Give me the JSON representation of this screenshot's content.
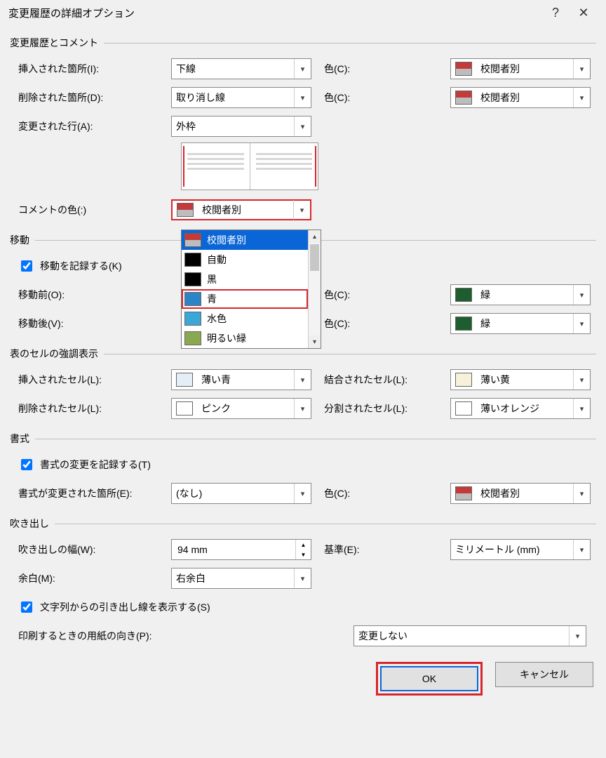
{
  "dialog": {
    "title": "変更履歴の詳細オプション"
  },
  "sections": {
    "tracking": "変更履歴とコメント",
    "move": "移動",
    "tableHighlight": "表のセルの強調表示",
    "format": "書式",
    "balloon": "吹き出し"
  },
  "labels": {
    "insert": "挿入された箇所(I):",
    "delete": "削除された箇所(D):",
    "changedLine": "変更された行(A):",
    "commentColor": "コメントの色(:)",
    "trackMove": "移動を記録する(K)",
    "moveBefore": "移動前(O):",
    "moveAfter": "移動後(V):",
    "cellInsert": "挿入されたセル(L):",
    "cellDelete": "削除されたセル(L):",
    "cellMerge": "結合されたセル(L):",
    "cellSplit": "分割されたセル(L):",
    "trackFormat": "書式の変更を記録する(T)",
    "formatChanged": "書式が変更された箇所(E):",
    "balloonWidth": "吹き出しの幅(W):",
    "reference": "基準(E):",
    "margin": "余白(M):",
    "showLeader": "文字列からの引き出し線を表示する(S)",
    "paperOrient": "印刷するときの用紙の向き(P):",
    "color": "色(C):"
  },
  "values": {
    "insert": "下線",
    "delete": "取り消し線",
    "changedLine": "外枠",
    "insertColor": "校閲者別",
    "deleteColor": "校閲者別",
    "commentColor": "校閲者別",
    "moveBeforeColor": "緑",
    "moveAfterColor": "緑",
    "cellInsert": "薄い青",
    "cellDelete": "ピンク",
    "cellMerge": "薄い黄",
    "cellSplit": "薄いオレンジ",
    "formatChanged": "(なし)",
    "formatColor": "校閲者別",
    "balloonWidth": "94 mm",
    "reference": "ミリメートル (mm)",
    "margin": "右余白",
    "paperOrient": "変更しない"
  },
  "dropdown": {
    "items": [
      {
        "label": "校閲者別",
        "color": "split",
        "selected": true
      },
      {
        "label": "自動",
        "color": "#000000"
      },
      {
        "label": "黒",
        "color": "#000000"
      },
      {
        "label": "青",
        "color": "#2a84c6",
        "highlight": true
      },
      {
        "label": "水色",
        "color": "#3ba7d6"
      },
      {
        "label": "明るい緑",
        "color": "#8aa850"
      }
    ]
  },
  "colors": {
    "green": "#1e5e2e",
    "lightBlue": "#e4eef6",
    "pink": "#ffffff",
    "lightYellow": "#f8f1da",
    "lightOrange": "#ffffff"
  },
  "footer": {
    "ok": "OK",
    "cancel": "キャンセル"
  }
}
